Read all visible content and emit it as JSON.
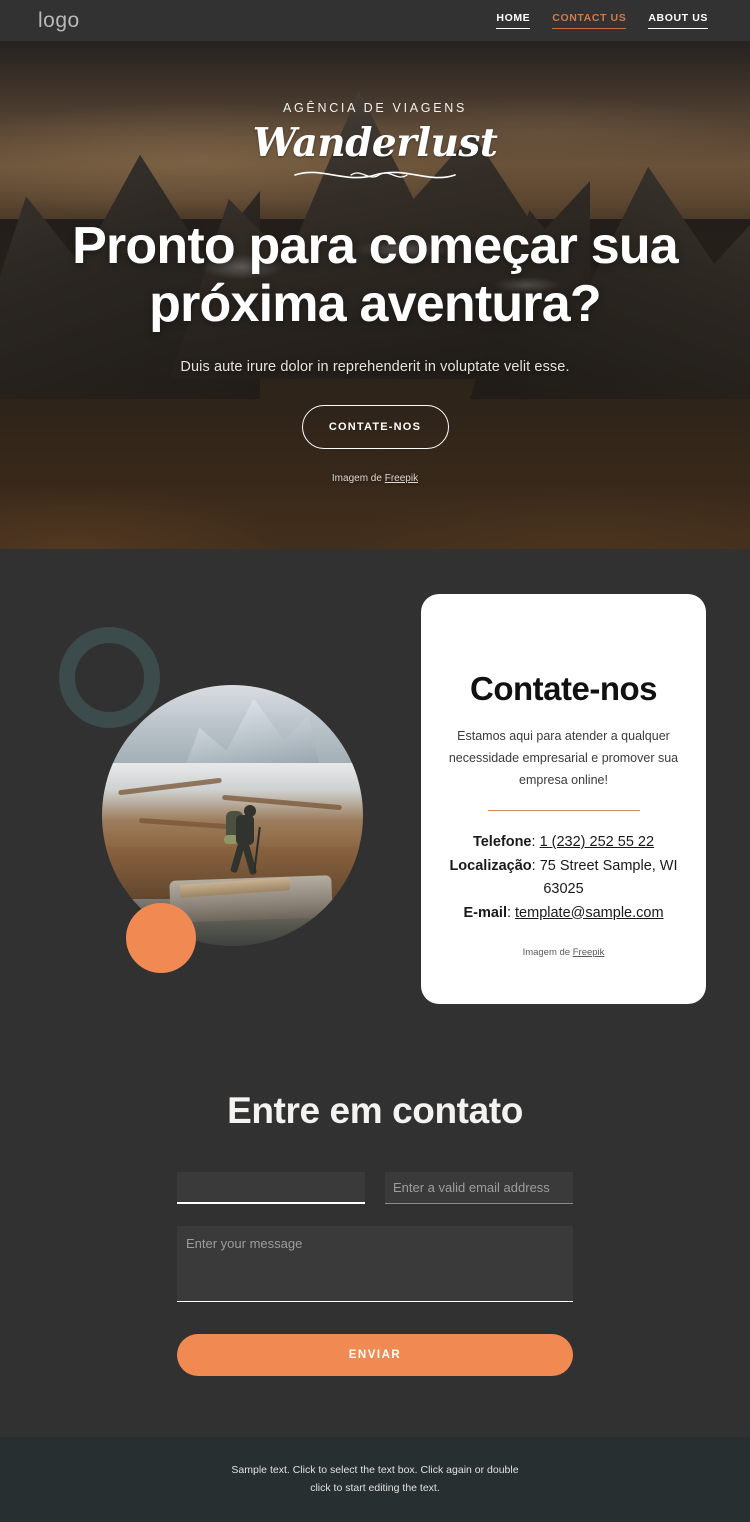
{
  "header": {
    "logo": "logo",
    "nav": [
      {
        "label": "HOME",
        "active": false
      },
      {
        "label": "CONTACT US",
        "active": true
      },
      {
        "label": "ABOUT US",
        "active": false
      }
    ]
  },
  "hero": {
    "eyebrow": "AGÊNCIA DE VIAGENS",
    "script_logo": "Wanderlust",
    "title": "Pronto para começar sua próxima aventura?",
    "subtitle": "Duis aute irure dolor in reprehenderit in voluptate velit esse.",
    "cta_label": "CONTATE-NOS",
    "credit_prefix": "Imagem de",
    "credit_link": "Freepik"
  },
  "contact_card": {
    "title": "Contate-nos",
    "description": "Estamos aqui para atender a qualquer necessidade empresarial e promover sua empresa online!",
    "phone_label": "Telefone",
    "phone_value": "1 (232) 252 55 22",
    "location_label": "Localização",
    "location_value": "75 Street Sample, WI 63025",
    "email_label": "E-mail",
    "email_value": "template@sample.com",
    "credit_prefix": "Imagem de",
    "credit_link": "Freepik"
  },
  "form": {
    "title": "Entre em contato",
    "name_value": "",
    "name_placeholder": "",
    "email_value": "",
    "email_placeholder": "Enter a valid email address",
    "message_value": "",
    "message_placeholder": "Enter your message",
    "submit_label": "ENVIAR"
  },
  "footer": {
    "line1": "Sample text. Click to select the text box. Click again or double",
    "line2": "click to start editing the text."
  },
  "colors": {
    "accent_orange": "#f08a52",
    "nav_active": "#d07a4a",
    "page_bg": "#313131",
    "footer_bg": "#272f31",
    "ring_teal": "#3c4b4c",
    "card_bg": "#ffffff"
  }
}
